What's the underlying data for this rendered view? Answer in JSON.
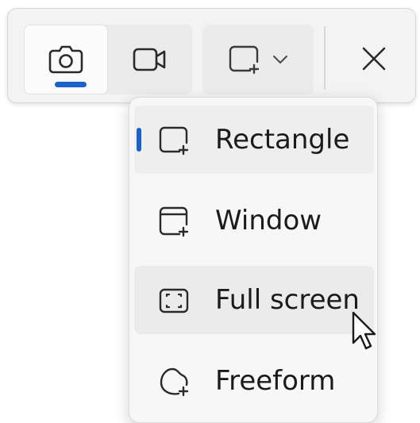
{
  "toolbar": {
    "modes": [
      {
        "name": "screenshot",
        "icon": "camera-icon",
        "active": true
      },
      {
        "name": "record",
        "icon": "video-camera-icon",
        "active": false
      }
    ],
    "shape_icon": "rectangle-snip-icon",
    "dropdown_icon": "chevron-down-icon",
    "close_icon": "close-icon"
  },
  "menu": {
    "items": [
      {
        "label": "Rectangle",
        "icon": "rectangle-snip-icon",
        "selected": true
      },
      {
        "label": "Window",
        "icon": "window-snip-icon",
        "selected": false
      },
      {
        "label": "Full screen",
        "icon": "fullscreen-snip-icon",
        "selected": false,
        "hovered": true
      },
      {
        "label": "Freeform",
        "icon": "freeform-snip-icon",
        "selected": false
      }
    ]
  },
  "colors": {
    "accent": "#1a62c9",
    "toolbar_bg": "#f3f3f3",
    "menu_bg": "#f7f7f7",
    "text": "#1b1b1b"
  }
}
